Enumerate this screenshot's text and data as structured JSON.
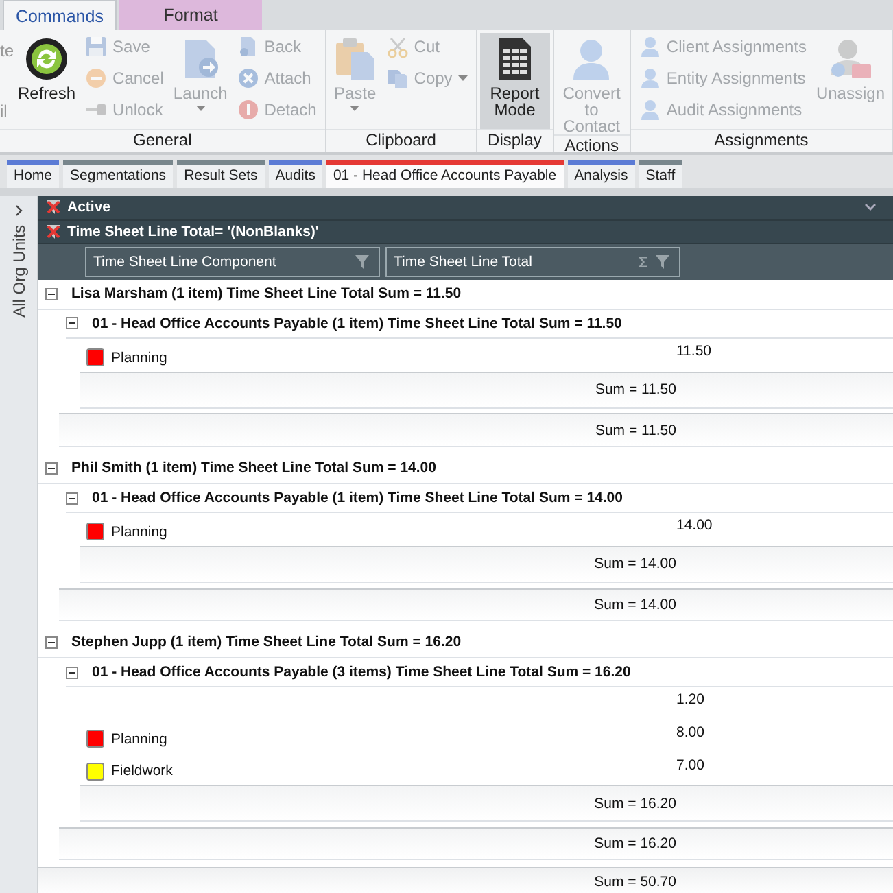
{
  "ribbon_tabs": [
    {
      "label": "Commands",
      "selected": true,
      "kind": "plain"
    },
    {
      "label": "Format",
      "selected": false,
      "kind": "context"
    }
  ],
  "ribbon": {
    "groups": [
      {
        "label": "General",
        "items": [
          {
            "kind": "fragment",
            "texts": [
              "te",
              "il"
            ]
          },
          {
            "kind": "large",
            "label": "Refresh",
            "disabled": false,
            "pressed": false,
            "menu": false
          },
          {
            "kind": "stack",
            "items": [
              {
                "label": "Save",
                "disabled": true,
                "menu": false
              },
              {
                "label": "Cancel",
                "disabled": true,
                "menu": false
              },
              {
                "label": "Unlock",
                "disabled": true,
                "menu": false
              }
            ]
          },
          {
            "kind": "large",
            "label": "Launch",
            "disabled": true,
            "pressed": false,
            "menu": true
          },
          {
            "kind": "stack",
            "items": [
              {
                "label": "Back",
                "disabled": true,
                "menu": false
              },
              {
                "label": "Attach",
                "disabled": true,
                "menu": false
              },
              {
                "label": "Detach",
                "disabled": true,
                "menu": false
              }
            ]
          }
        ]
      },
      {
        "label": "Clipboard",
        "items": [
          {
            "kind": "large",
            "label": "Paste",
            "disabled": true,
            "pressed": false,
            "menu": true
          },
          {
            "kind": "stack",
            "items": [
              {
                "label": "Cut",
                "disabled": true,
                "menu": false
              },
              {
                "label": "Copy",
                "disabled": true,
                "menu": true
              }
            ]
          }
        ]
      },
      {
        "label": "Display",
        "items": [
          {
            "kind": "large",
            "label": "Report Mode",
            "disabled": false,
            "pressed": true,
            "menu": false
          }
        ]
      },
      {
        "label": "Actions",
        "items": [
          {
            "kind": "large",
            "label": "Convert to Contact",
            "disabled": true,
            "pressed": false,
            "menu": false
          }
        ]
      },
      {
        "label": "Assignments",
        "items": [
          {
            "kind": "stack",
            "items": [
              {
                "label": "Client Assignments",
                "disabled": true,
                "menu": false
              },
              {
                "label": "Entity Assignments",
                "disabled": true,
                "menu": false
              },
              {
                "label": "Audit Assignments",
                "disabled": true,
                "menu": false
              }
            ]
          },
          {
            "kind": "large",
            "label": "Unassign",
            "disabled": true,
            "pressed": false,
            "menu": false
          }
        ]
      }
    ]
  },
  "document_tabs": [
    {
      "label": "Home",
      "color": "#5b7bd5",
      "selected": false
    },
    {
      "label": "Segmentations",
      "color": "#78868c",
      "selected": false
    },
    {
      "label": "Result Sets",
      "color": "#78868c",
      "selected": false
    },
    {
      "label": "Audits",
      "color": "#5b7bd5",
      "selected": false
    },
    {
      "label": "01 - Head Office Accounts Payable",
      "color": "#e53935",
      "selected": true
    },
    {
      "label": "Analysis",
      "color": "#5b7bd5",
      "selected": false
    },
    {
      "label": "Staff",
      "color": "#78868c",
      "selected": false
    }
  ],
  "sidebar": {
    "label": "All Org Units"
  },
  "filters": [
    {
      "text": "Active"
    },
    {
      "text": "Time Sheet Line Total= '(NonBlanks)'"
    }
  ],
  "columns": [
    {
      "title": "Time Sheet Line Component",
      "summary": false
    },
    {
      "title": "Time Sheet Line Total",
      "summary": true
    }
  ],
  "groups": [
    {
      "title": "Lisa Marsham (1 item) Time Sheet Line Total Sum = 11.50",
      "expanded": true,
      "sum": "Sum = 11.50",
      "subgroups": [
        {
          "title": "01 - Head Office Accounts Payable (1 item) Time Sheet Line Total Sum = 11.50",
          "expanded": true,
          "sum": "Sum = 11.50",
          "rows": [
            {
              "component": "Planning",
              "color": "#ff0000",
              "total": "11.50"
            }
          ]
        }
      ]
    },
    {
      "title": "Phil Smith (1 item) Time Sheet Line Total Sum = 14.00",
      "expanded": true,
      "sum": "Sum = 14.00",
      "subgroups": [
        {
          "title": "01 - Head Office Accounts Payable (1 item) Time Sheet Line Total Sum = 14.00",
          "expanded": true,
          "sum": "Sum = 14.00",
          "rows": [
            {
              "component": "Planning",
              "color": "#ff0000",
              "total": "14.00"
            }
          ]
        }
      ]
    },
    {
      "title": "Stephen Jupp (1 item) Time Sheet Line Total Sum = 16.20",
      "expanded": true,
      "sum": "Sum = 16.20",
      "subgroups": [
        {
          "title": "01 - Head Office Accounts Payable (3 items) Time Sheet Line Total Sum = 16.20",
          "expanded": true,
          "sum": "Sum = 16.20",
          "rows": [
            {
              "total": "1.20"
            },
            {
              "component": "Planning",
              "color": "#ff0000",
              "total": "8.00"
            },
            {
              "component": "Fieldwork",
              "color": "#ffff00",
              "total": "7.00"
            }
          ]
        }
      ]
    }
  ],
  "grand_sum": "Sum = 50.70"
}
